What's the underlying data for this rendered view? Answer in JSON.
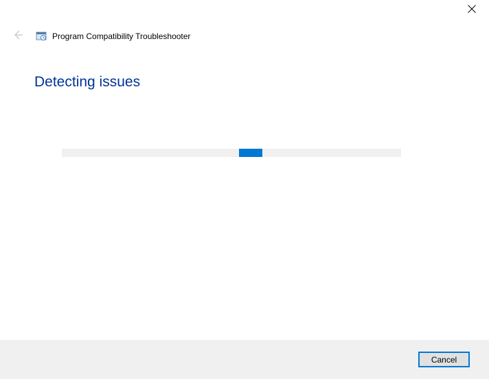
{
  "window": {
    "title": "Program Compatibility Troubleshooter"
  },
  "heading": "Detecting issues",
  "buttons": {
    "cancel": "Cancel"
  }
}
